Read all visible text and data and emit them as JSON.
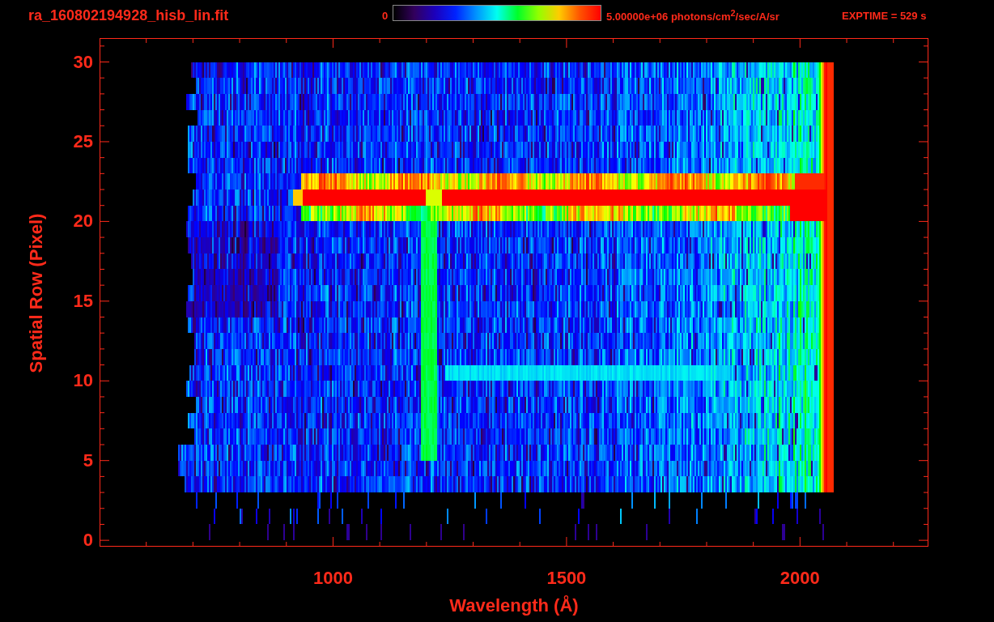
{
  "header": {
    "file_name": "ra_160802194928_hisb_lin.fit",
    "colorbar": {
      "min_label": "0",
      "max_label": "5.00000e+06 photons/cm$^{2}$/sec/A/sr"
    },
    "exposure": "EXPTIME = 529 s"
  },
  "plot": {
    "xlabel": "Wavelength (Å)",
    "ylabel": "Spatial Row (Pixel)",
    "xticks": [
      "1000",
      "1500",
      "2000"
    ],
    "yticks": [
      "30",
      "25",
      "20",
      "15",
      "10",
      "5",
      "0"
    ]
  }
}
